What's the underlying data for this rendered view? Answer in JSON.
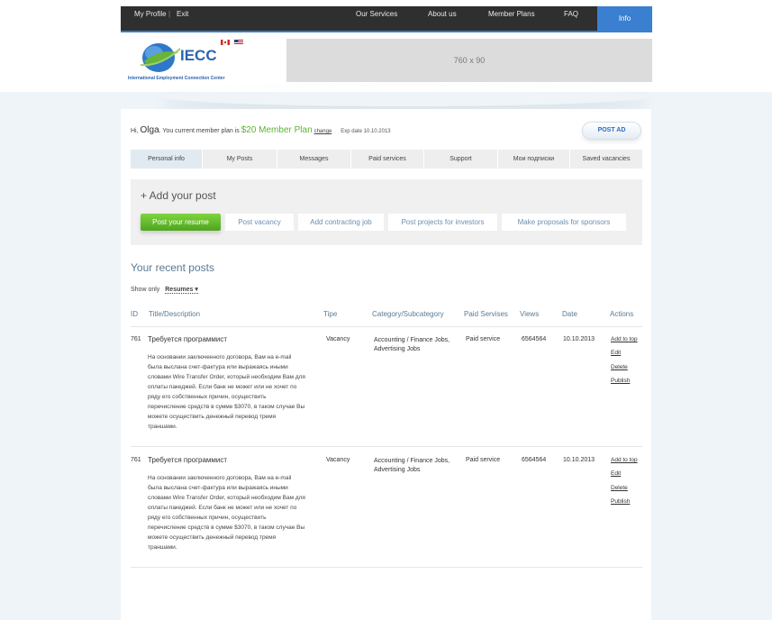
{
  "nav": {
    "my_profile": "My Profile",
    "separator": "|",
    "exit": "Exit",
    "our_services": "Our Services",
    "about_us": "About us",
    "member_plans": "Member Plans",
    "faq": "FAQ",
    "info": "Info"
  },
  "header": {
    "logo_text": "IECC",
    "logo_sub": "International Employment Connection Center",
    "banner": "760 x 90"
  },
  "account": {
    "hi": "Hi,",
    "name": "Olga",
    "plan_prefix": ". You current member plan is",
    "plan": "$20 Member Plan",
    "change": "change",
    "exp": "Exp date 10.10.2013",
    "post_ad": "POST AD"
  },
  "tabs": [
    "Personal info",
    "My Posts",
    "Messages",
    "Paid services",
    "Support",
    "Мои подписки",
    "Saved vacancies"
  ],
  "add_post": {
    "title": "+ Add your post",
    "buttons": [
      "Post your resume",
      "Post vacancy",
      "Add contracting job",
      "Post projects for investors",
      "Make proposals for sponsors"
    ]
  },
  "recent": {
    "title": "Your recent posts",
    "show_only": "Show only",
    "filter": "Resumes ▾"
  },
  "table": {
    "headers": [
      "ID",
      "Title/Description",
      "Tipe",
      "Category/Subcategory",
      "Paid Servises",
      "Views",
      "Date",
      "Actions"
    ],
    "rows": [
      {
        "id": "761",
        "title": "Требуется программист",
        "desc": "На основании заключенного договора, Вам на e-mail была выслана счет-фактура или выражаясь иными словами Wire Transfer Order, который необходим Вам для оплаты пакеджей. Если банк не может или не хочет по ряду его собственных причин, осуществить перечисление средств в сумме $3070, в таком случае Вы можете осуществить денежный перевод тремя траншами.",
        "type": "Vacancy",
        "category": "Accounting / Finance Jobs, Advertising Jobs",
        "paid": "Paid service",
        "views": "6564564",
        "date": "10.10.2013",
        "actions": [
          "Add to top",
          "Edit",
          "Delete",
          "Publish"
        ]
      },
      {
        "id": "761",
        "title": "Требуется программист",
        "desc": "На основании заключенного договора, Вам на e-mail была выслана счет-фактура или выражаясь иными словами Wire Transfer Order, который необходим Вам для оплаты пакеджей. Если банк не может или не хочет по ряду его собственных причин, осуществить перечисление средств в сумме $3070, в таком случае Вы можете осуществить денежный перевод тремя траншами.",
        "type": "Vacancy",
        "category": "Accounting / Finance Jobs, Advertising Jobs",
        "paid": "Paid service",
        "views": "6564564",
        "date": "10.10.2013",
        "actions": [
          "Add to top",
          "Edit",
          "Delete",
          "Publish"
        ]
      }
    ]
  },
  "colors": {
    "accent_blue": "#3b7fd1",
    "plan_green": "#5db52f",
    "topbar": "#2f2f2f"
  }
}
